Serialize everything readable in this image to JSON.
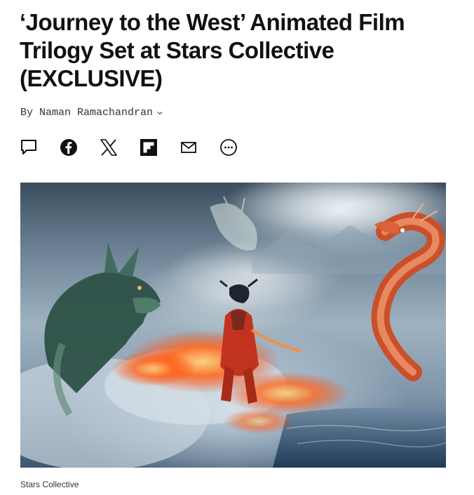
{
  "article": {
    "headline": "‘Journey to the West’ Animated Film Trilogy Set at Stars Collective (EXCLUSIVE)",
    "byline": "By Naman Ramachandran",
    "byline_menu_icon": "chevron-down-icon"
  },
  "share": {
    "icons": [
      "comment-icon",
      "facebook-icon",
      "x-icon",
      "flipboard-icon",
      "email-icon",
      "more-icon"
    ]
  },
  "hero_image": {
    "subject": "artwork",
    "caption": "Stars Collective"
  },
  "colors": {
    "text": "#111111",
    "byline": "#333333",
    "background": "#ffffff"
  }
}
